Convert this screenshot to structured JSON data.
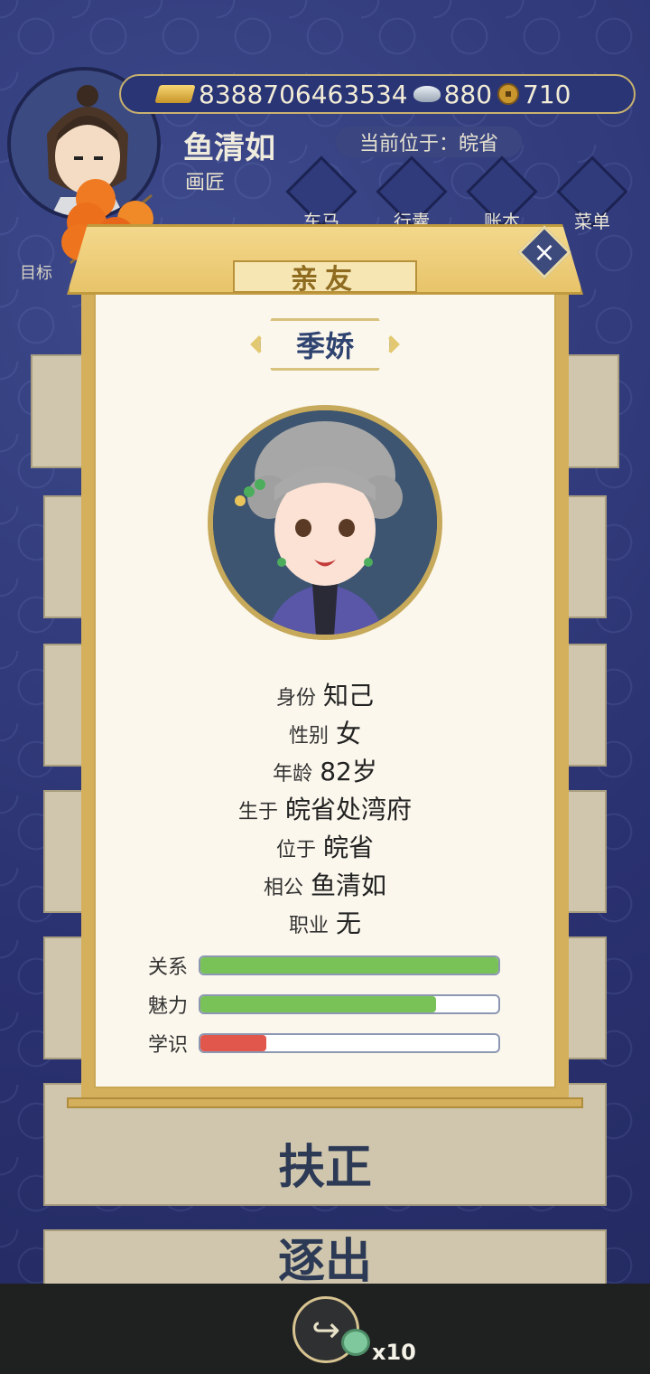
{
  "header": {
    "gold": "8388706463534",
    "silver": "880",
    "coins": "710",
    "player_name": "鱼清如",
    "player_job": "画匠",
    "location": "当前位于：皖省",
    "target_label": "目标"
  },
  "nav": [
    {
      "label": "车马",
      "icon": "carriage-icon"
    },
    {
      "label": "行囊",
      "icon": "bag-icon"
    },
    {
      "label": "账本",
      "icon": "ledger-icon"
    },
    {
      "label": "菜单",
      "icon": "more-icon"
    }
  ],
  "background_cards": {
    "card_fuzheng": "扶正",
    "card_zhuchu": "逐出"
  },
  "modal": {
    "title": "亲友",
    "name": "季娇",
    "info": [
      {
        "key": "身份",
        "value": "知己"
      },
      {
        "key": "性别",
        "value": "女"
      },
      {
        "key": "年龄",
        "value": "82岁"
      },
      {
        "key": "生于",
        "value": "皖省处湾府"
      },
      {
        "key": "位于",
        "value": "皖省"
      },
      {
        "key": "相公",
        "value": "鱼清如"
      },
      {
        "key": "职业",
        "value": "无"
      }
    ],
    "stats": [
      {
        "key": "关系",
        "fraction": 1.0,
        "color": "#79c257"
      },
      {
        "key": "魅力",
        "fraction": 0.79,
        "color": "#79c257"
      },
      {
        "key": "学识",
        "fraction": 0.22,
        "color": "#e2574c"
      }
    ]
  },
  "footer": {
    "share_count": "x10"
  }
}
